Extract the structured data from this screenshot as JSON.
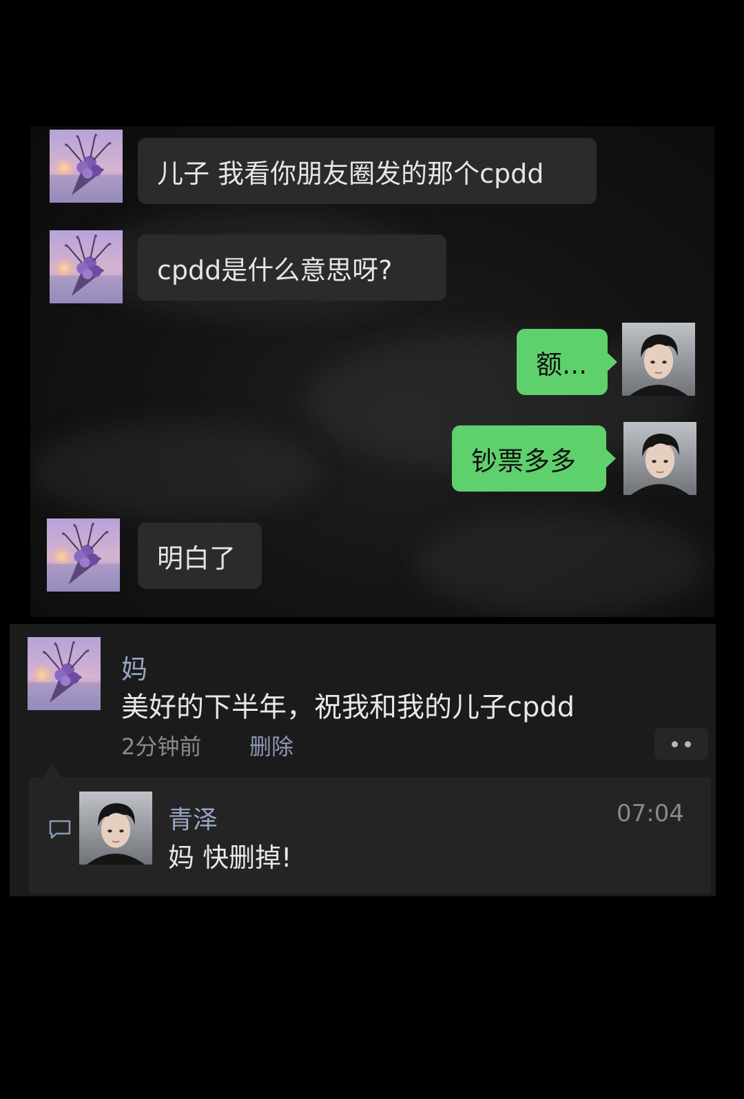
{
  "chat": {
    "messages": [
      {
        "sender": "mom",
        "text": "儿子 我看你朋友圈发的那个cpdd"
      },
      {
        "sender": "mom",
        "text": "cpdd是什么意思呀?"
      },
      {
        "sender": "son",
        "text": "额..."
      },
      {
        "sender": "son",
        "text": "钞票多多"
      },
      {
        "sender": "mom",
        "text": "明白了"
      }
    ]
  },
  "post": {
    "author": "妈",
    "text": "美好的下半年，祝我和我的儿子cpdd",
    "time": "2分钟前",
    "delete_label": "删除"
  },
  "comment": {
    "author": "青泽",
    "time": "07:04",
    "text": "妈 快删掉!"
  },
  "icons": {
    "mom_avatar": "flower-bouquet-avatar-icon",
    "son_avatar": "portrait-avatar-icon",
    "more": "more-dots-icon",
    "comment": "comment-icon"
  },
  "colors": {
    "outgoing_bubble": "#5fd16c",
    "incoming_bubble": "#2b2b2b",
    "link_name": "#9aa6c6"
  }
}
